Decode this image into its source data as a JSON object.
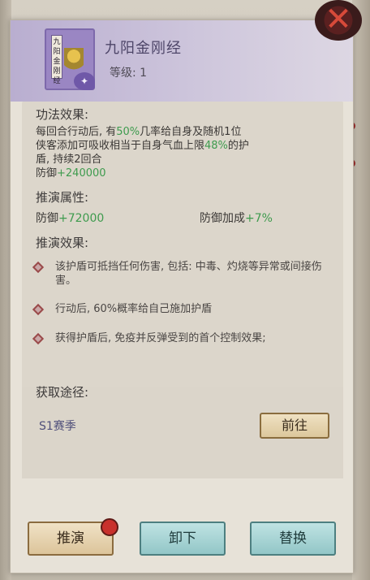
{
  "header": {
    "book_label": "九阳金刚经",
    "title": "九阳金刚经",
    "level": "等级: 1"
  },
  "skill_effect": {
    "heading": "功法效果:",
    "line1_pre": "每回合行动后, 有",
    "line1_pct": "50%",
    "line1_post": "几率给自身及随机1位",
    "line2_pre": "侠客添加可吸收相当于自身气血上限",
    "line2_pct": "48%",
    "line2_post": "的护",
    "line3": "盾, 持续2回合",
    "defense_label": "防御",
    "defense_value": "+240000"
  },
  "deduce_attrs": {
    "heading": "推演属性:",
    "attr1_label": "防御",
    "attr1_value": "+72000",
    "attr2_label": "防御加成",
    "attr2_value": "+7%"
  },
  "deduce_effects": {
    "heading": "推演效果:",
    "items": [
      "该护盾可抵挡任何伤害, 包括: 中毒、灼烧等异常或间接伤害。",
      "行动后, 60%概率给自己施加护盾",
      "获得护盾后, 免疫并反弹受到的首个控制效果;"
    ]
  },
  "source": {
    "heading": "获取途径:",
    "season": "S1赛季",
    "go_label": "前往"
  },
  "buttons": {
    "deduce": "推演",
    "unload": "卸下",
    "replace": "替换"
  },
  "colors": {
    "highlight_green": "#3e9b4e",
    "header_purple": "#b9aed0",
    "close_red": "#d84a3a"
  }
}
